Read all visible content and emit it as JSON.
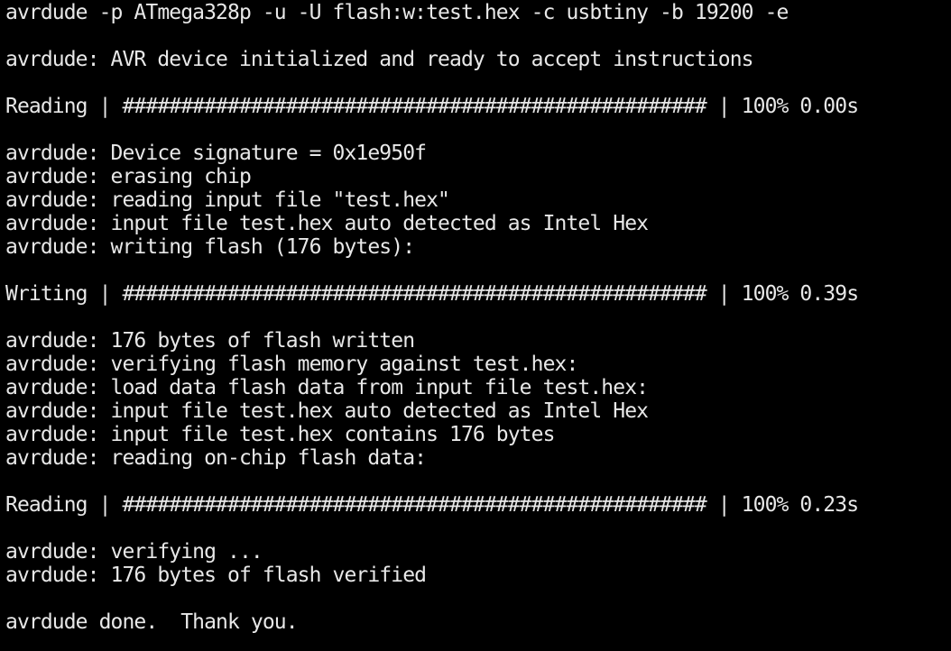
{
  "terminal": {
    "lines": [
      "avrdude -p ATmega328p -u -U flash:w:test.hex -c usbtiny -b 19200 -e",
      "",
      "avrdude: AVR device initialized and ready to accept instructions",
      "",
      "Reading | ################################################## | 100% 0.00s",
      "",
      "avrdude: Device signature = 0x1e950f",
      "avrdude: erasing chip",
      "avrdude: reading input file \"test.hex\"",
      "avrdude: input file test.hex auto detected as Intel Hex",
      "avrdude: writing flash (176 bytes):",
      "",
      "Writing | ################################################## | 100% 0.39s",
      "",
      "avrdude: 176 bytes of flash written",
      "avrdude: verifying flash memory against test.hex:",
      "avrdude: load data flash data from input file test.hex:",
      "avrdude: input file test.hex auto detected as Intel Hex",
      "avrdude: input file test.hex contains 176 bytes",
      "avrdude: reading on-chip flash data:",
      "",
      "Reading | ################################################## | 100% 0.23s",
      "",
      "avrdude: verifying ...",
      "avrdude: 176 bytes of flash verified",
      "",
      "avrdude done.  Thank you."
    ]
  }
}
